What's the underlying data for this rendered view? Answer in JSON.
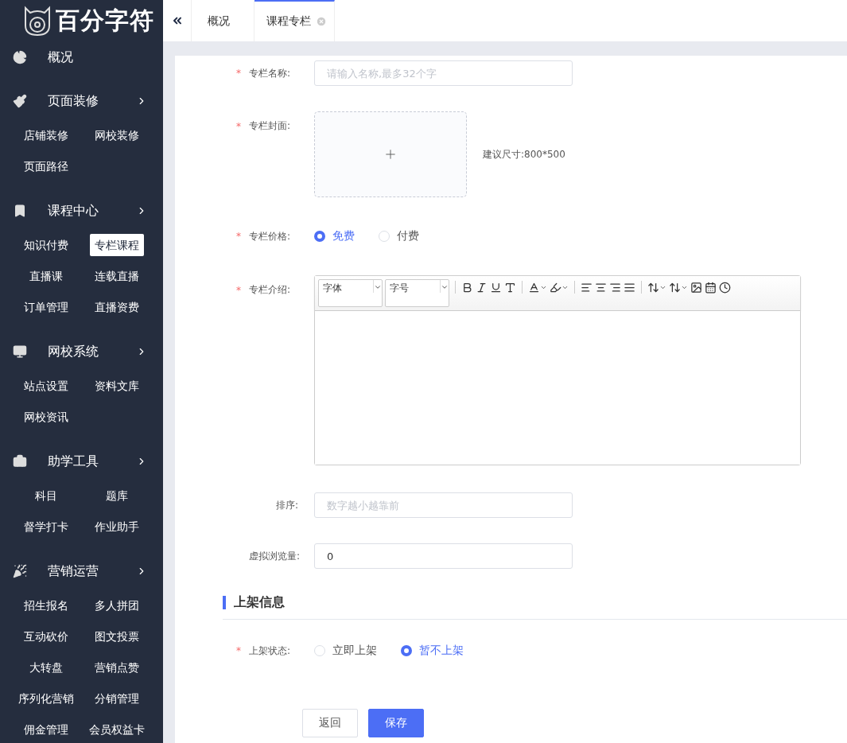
{
  "logo": {
    "text": "百分字符"
  },
  "tabs": [
    {
      "label": "概况",
      "selected": false,
      "closable": false
    },
    {
      "label": "课程专栏",
      "selected": true,
      "closable": true
    }
  ],
  "sidebar": {
    "items": [
      {
        "label": "概况"
      },
      {
        "label": "页面装修",
        "children": [
          {
            "label": "店铺装修",
            "selected": false
          },
          {
            "label": "网校装修",
            "selected": false
          },
          {
            "label": "页面路径",
            "selected": false
          }
        ]
      },
      {
        "label": "课程中心",
        "children": [
          {
            "label": "知识付费",
            "selected": false
          },
          {
            "label": "专栏课程",
            "selected": true
          },
          {
            "label": "直播课",
            "selected": false
          },
          {
            "label": "连载直播",
            "selected": false
          },
          {
            "label": "订单管理",
            "selected": false
          },
          {
            "label": "直播资费",
            "selected": false
          }
        ]
      },
      {
        "label": "网校系统",
        "children": [
          {
            "label": "站点设置",
            "selected": false
          },
          {
            "label": "资料文库",
            "selected": false
          },
          {
            "label": "网校资讯",
            "selected": false
          }
        ]
      },
      {
        "label": "助学工具",
        "children": [
          {
            "label": "科目",
            "selected": false
          },
          {
            "label": "题库",
            "selected": false
          },
          {
            "label": "督学打卡",
            "selected": false
          },
          {
            "label": "作业助手",
            "selected": false
          }
        ]
      },
      {
        "label": "营销运营",
        "children": [
          {
            "label": "招生报名",
            "selected": false
          },
          {
            "label": "多人拼团",
            "selected": false
          },
          {
            "label": "互动砍价",
            "selected": false
          },
          {
            "label": "图文投票",
            "selected": false
          },
          {
            "label": "大转盘",
            "selected": false
          },
          {
            "label": "营销点赞",
            "selected": false
          },
          {
            "label": "序列化营销",
            "selected": false
          },
          {
            "label": "分销管理",
            "selected": false
          },
          {
            "label": "佣金管理",
            "selected": false
          },
          {
            "label": "会员权益卡",
            "selected": false
          }
        ]
      }
    ]
  },
  "form": {
    "fields": [
      {
        "kind": "text",
        "label": "专栏名称:",
        "required_mark": "*",
        "placeholder": "请输入名称,最多32个字"
      },
      {
        "kind": "upload",
        "label": "专栏封面:",
        "required_mark": "*",
        "hint": "建议尺寸:800*500"
      },
      {
        "kind": "radio",
        "label": "专栏价格:",
        "required_mark": "*",
        "options": [
          {
            "label": "免费",
            "selected": true
          },
          {
            "label": "付费",
            "selected": false
          }
        ]
      },
      {
        "kind": "editor",
        "label": "专栏介绍:",
        "required_mark": "*",
        "font_select": "字体",
        "size_select": "字号"
      },
      {
        "kind": "text",
        "label": "排序:",
        "placeholder": "数字越小越靠前"
      },
      {
        "kind": "text",
        "label": "虚拟浏览量:",
        "value": "0"
      }
    ],
    "section": {
      "title": "上架信息"
    },
    "section_fields": [
      {
        "kind": "radio",
        "label": "上架状态:",
        "required_mark": "*",
        "options": [
          {
            "label": "立即上架",
            "selected": false
          },
          {
            "label": "暂不上架",
            "selected": true
          }
        ]
      }
    ],
    "buttons": [
      {
        "label": "返回",
        "kind": "secondary"
      },
      {
        "label": "保存",
        "kind": "primary"
      }
    ]
  }
}
